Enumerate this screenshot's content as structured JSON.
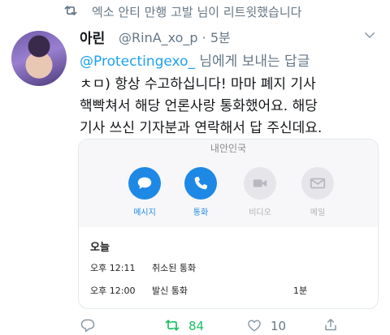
{
  "retweet_context": "엑소 안티 만행 고발 님이 리트윗했습니다",
  "tweet": {
    "author_name": "아린",
    "author_handle": "@RinA_xo_p · 5분",
    "reply_mention": "@Protectingexo_",
    "reply_suffix": " 님에게 보내는 답글",
    "body_lines": [
      "ㅊㅁ) 항상 수고하십니다! 마마 폐지 기사",
      "핵빡쳐서 해당 언론사랑 통화했어요. 해당",
      "기사 쓰신 기자분과 연락해서 답 주신데요."
    ]
  },
  "card": {
    "header_text": "내안인국",
    "actions": [
      {
        "label": "메시지",
        "active": true,
        "icon": "message-icon"
      },
      {
        "label": "통화",
        "active": true,
        "icon": "phone-icon"
      },
      {
        "label": "비디오",
        "active": false,
        "icon": "video-icon"
      },
      {
        "label": "메일",
        "active": false,
        "icon": "mail-icon"
      }
    ],
    "log_title": "오늘",
    "call_log": [
      {
        "time": "오후 12:11",
        "type": "취소된 통화",
        "duration": ""
      },
      {
        "time": "오후 12:00",
        "type": "발신 통화",
        "duration": "1분"
      }
    ]
  },
  "action_bar": {
    "retweet_count": "84",
    "like_count": "10"
  },
  "colors": {
    "link": "#1da1f2",
    "retweet_active": "#17bf63",
    "muted": "#657786",
    "card_accent": "#1e88e5"
  }
}
